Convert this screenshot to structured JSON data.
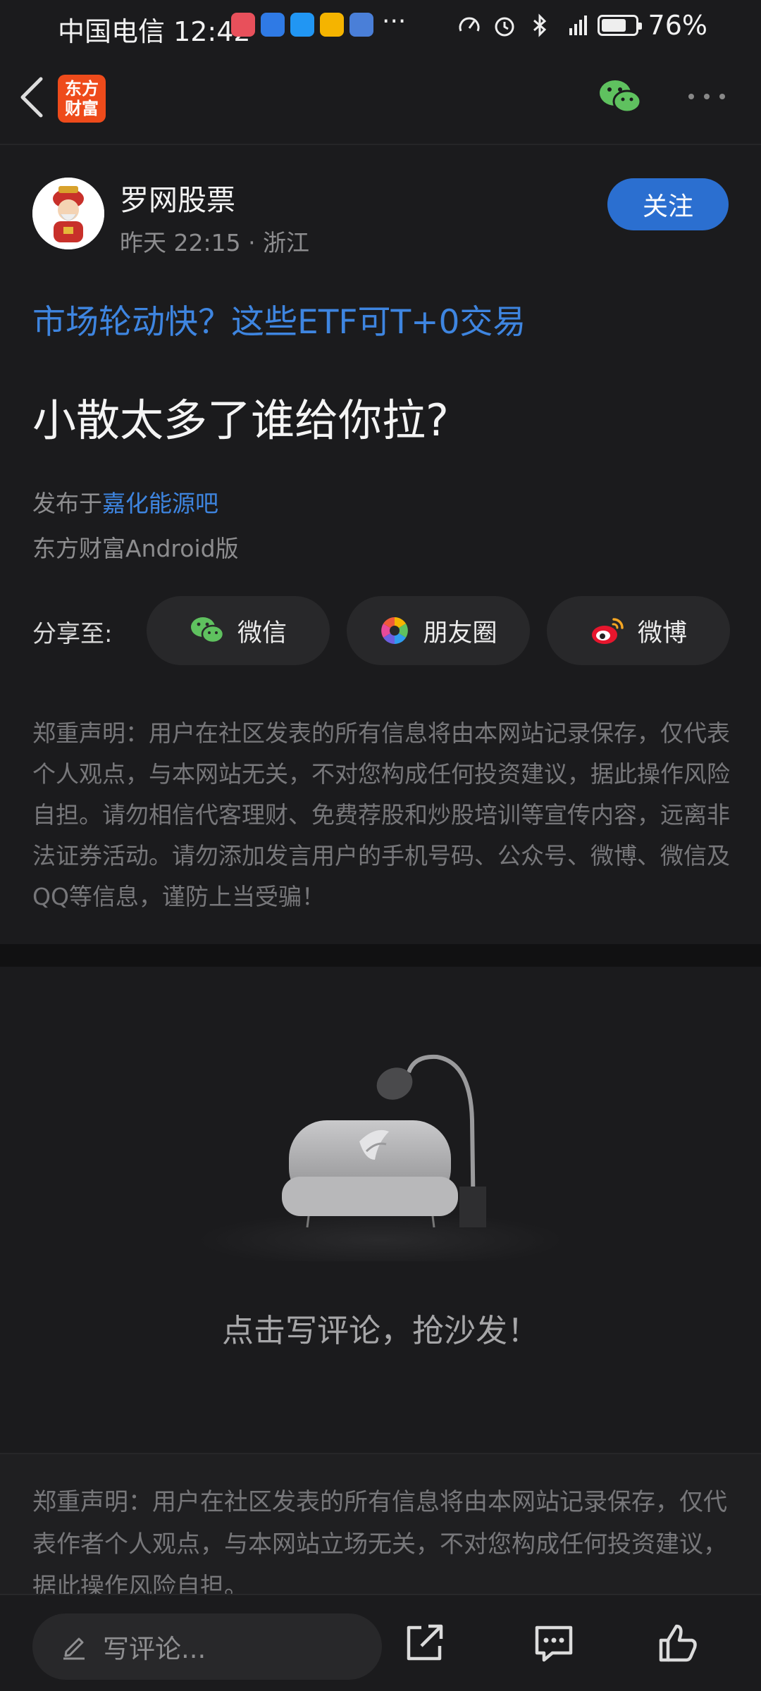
{
  "status": {
    "carrier_time": "中国电信 12:42",
    "more": "···",
    "battery": "76%",
    "battery_level": 0.76
  },
  "nav": {
    "logo_text": "东方财富"
  },
  "author": {
    "name": "罗网股票",
    "meta": "昨天 22:15 · 浙江",
    "follow_label": "关注"
  },
  "ad_link": "市场轮动快？这些ETF可T+0交易",
  "post": {
    "title": "小散太多了谁给你拉?",
    "published_prefix": "发布于",
    "published_bar": "嘉化能源吧",
    "device": "东方财富Android版"
  },
  "share": {
    "label": "分享至:",
    "items": [
      {
        "label": "微信",
        "icon": "wechat-icon"
      },
      {
        "label": "朋友圈",
        "icon": "moments-icon"
      },
      {
        "label": "微博",
        "icon": "weibo-icon"
      }
    ]
  },
  "disclaimer": "郑重声明：用户在社区发表的所有信息将由本网站记录保存，仅代表个人观点，与本网站无关，不对您构成任何投资建议，据此操作风险自担。请勿相信代客理财、免费荐股和炒股培训等宣传内容，远离非法证券活动。请勿添加发言用户的手机号码、公众号、微博、微信及QQ等信息，谨防上当受骗！",
  "comments": {
    "empty_text": "点击写评论，抢沙发！"
  },
  "footer_disclaimer": "郑重声明：用户在社区发表的所有信息将由本网站记录保存，仅代表作者个人观点，与本网站立场无关，不对您构成任何投资建议，据此操作风险自担。",
  "bottom": {
    "input_placeholder": "写评论..."
  },
  "colors": {
    "accent_blue": "#2b6fd0",
    "link_blue": "#3e85e0",
    "background": "#1b1b1d",
    "logo_orange": "#ee4b1b"
  }
}
